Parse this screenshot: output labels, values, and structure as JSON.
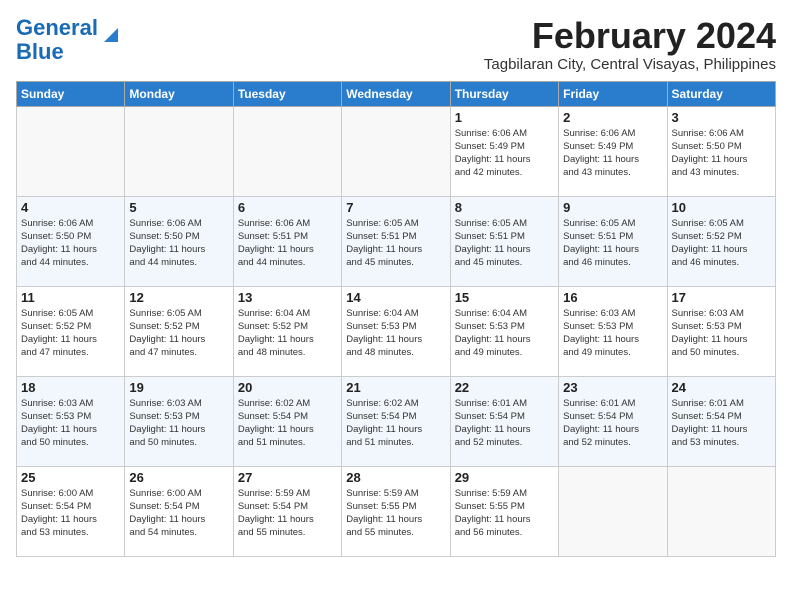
{
  "logo": {
    "line1": "General",
    "line2": "Blue"
  },
  "title": {
    "month_year": "February 2024",
    "location": "Tagbilaran City, Central Visayas, Philippines"
  },
  "headers": [
    "Sunday",
    "Monday",
    "Tuesday",
    "Wednesday",
    "Thursday",
    "Friday",
    "Saturday"
  ],
  "weeks": [
    [
      {
        "day": "",
        "info": ""
      },
      {
        "day": "",
        "info": ""
      },
      {
        "day": "",
        "info": ""
      },
      {
        "day": "",
        "info": ""
      },
      {
        "day": "1",
        "info": "Sunrise: 6:06 AM\nSunset: 5:49 PM\nDaylight: 11 hours\nand 42 minutes."
      },
      {
        "day": "2",
        "info": "Sunrise: 6:06 AM\nSunset: 5:49 PM\nDaylight: 11 hours\nand 43 minutes."
      },
      {
        "day": "3",
        "info": "Sunrise: 6:06 AM\nSunset: 5:50 PM\nDaylight: 11 hours\nand 43 minutes."
      }
    ],
    [
      {
        "day": "4",
        "info": "Sunrise: 6:06 AM\nSunset: 5:50 PM\nDaylight: 11 hours\nand 44 minutes."
      },
      {
        "day": "5",
        "info": "Sunrise: 6:06 AM\nSunset: 5:50 PM\nDaylight: 11 hours\nand 44 minutes."
      },
      {
        "day": "6",
        "info": "Sunrise: 6:06 AM\nSunset: 5:51 PM\nDaylight: 11 hours\nand 44 minutes."
      },
      {
        "day": "7",
        "info": "Sunrise: 6:05 AM\nSunset: 5:51 PM\nDaylight: 11 hours\nand 45 minutes."
      },
      {
        "day": "8",
        "info": "Sunrise: 6:05 AM\nSunset: 5:51 PM\nDaylight: 11 hours\nand 45 minutes."
      },
      {
        "day": "9",
        "info": "Sunrise: 6:05 AM\nSunset: 5:51 PM\nDaylight: 11 hours\nand 46 minutes."
      },
      {
        "day": "10",
        "info": "Sunrise: 6:05 AM\nSunset: 5:52 PM\nDaylight: 11 hours\nand 46 minutes."
      }
    ],
    [
      {
        "day": "11",
        "info": "Sunrise: 6:05 AM\nSunset: 5:52 PM\nDaylight: 11 hours\nand 47 minutes."
      },
      {
        "day": "12",
        "info": "Sunrise: 6:05 AM\nSunset: 5:52 PM\nDaylight: 11 hours\nand 47 minutes."
      },
      {
        "day": "13",
        "info": "Sunrise: 6:04 AM\nSunset: 5:52 PM\nDaylight: 11 hours\nand 48 minutes."
      },
      {
        "day": "14",
        "info": "Sunrise: 6:04 AM\nSunset: 5:53 PM\nDaylight: 11 hours\nand 48 minutes."
      },
      {
        "day": "15",
        "info": "Sunrise: 6:04 AM\nSunset: 5:53 PM\nDaylight: 11 hours\nand 49 minutes."
      },
      {
        "day": "16",
        "info": "Sunrise: 6:03 AM\nSunset: 5:53 PM\nDaylight: 11 hours\nand 49 minutes."
      },
      {
        "day": "17",
        "info": "Sunrise: 6:03 AM\nSunset: 5:53 PM\nDaylight: 11 hours\nand 50 minutes."
      }
    ],
    [
      {
        "day": "18",
        "info": "Sunrise: 6:03 AM\nSunset: 5:53 PM\nDaylight: 11 hours\nand 50 minutes."
      },
      {
        "day": "19",
        "info": "Sunrise: 6:03 AM\nSunset: 5:53 PM\nDaylight: 11 hours\nand 50 minutes."
      },
      {
        "day": "20",
        "info": "Sunrise: 6:02 AM\nSunset: 5:54 PM\nDaylight: 11 hours\nand 51 minutes."
      },
      {
        "day": "21",
        "info": "Sunrise: 6:02 AM\nSunset: 5:54 PM\nDaylight: 11 hours\nand 51 minutes."
      },
      {
        "day": "22",
        "info": "Sunrise: 6:01 AM\nSunset: 5:54 PM\nDaylight: 11 hours\nand 52 minutes."
      },
      {
        "day": "23",
        "info": "Sunrise: 6:01 AM\nSunset: 5:54 PM\nDaylight: 11 hours\nand 52 minutes."
      },
      {
        "day": "24",
        "info": "Sunrise: 6:01 AM\nSunset: 5:54 PM\nDaylight: 11 hours\nand 53 minutes."
      }
    ],
    [
      {
        "day": "25",
        "info": "Sunrise: 6:00 AM\nSunset: 5:54 PM\nDaylight: 11 hours\nand 53 minutes."
      },
      {
        "day": "26",
        "info": "Sunrise: 6:00 AM\nSunset: 5:54 PM\nDaylight: 11 hours\nand 54 minutes."
      },
      {
        "day": "27",
        "info": "Sunrise: 5:59 AM\nSunset: 5:54 PM\nDaylight: 11 hours\nand 55 minutes."
      },
      {
        "day": "28",
        "info": "Sunrise: 5:59 AM\nSunset: 5:55 PM\nDaylight: 11 hours\nand 55 minutes."
      },
      {
        "day": "29",
        "info": "Sunrise: 5:59 AM\nSunset: 5:55 PM\nDaylight: 11 hours\nand 56 minutes."
      },
      {
        "day": "",
        "info": ""
      },
      {
        "day": "",
        "info": ""
      }
    ]
  ]
}
